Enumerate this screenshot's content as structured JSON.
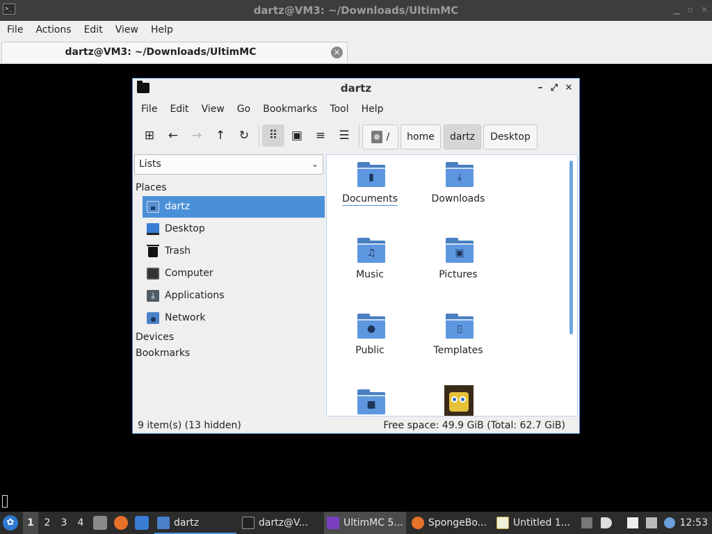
{
  "terminal": {
    "title": "dartz@VM3: ~/Downloads/UltimMC",
    "menu": [
      "File",
      "Actions",
      "Edit",
      "View",
      "Help"
    ],
    "tab_label": "dartz@VM3: ~/Downloads/UltimMC",
    "tab_close": "×",
    "window_controls": [
      "▁",
      "▫",
      "✕"
    ]
  },
  "file_manager": {
    "title": "dartz",
    "controls": {
      "minimize": "–",
      "maximize": "⤢",
      "close": "✕"
    },
    "menu": [
      "File",
      "Edit",
      "View",
      "Go",
      "Bookmarks",
      "Tool",
      "Help"
    ],
    "toolbar": {
      "new_tab": "⊞",
      "back": "←",
      "forward": "→",
      "up": "↑",
      "reload": "↻",
      "icon_view": "⠿",
      "thumbnail_view": "▣",
      "compact_view": "≡",
      "detailed_view": "☰"
    },
    "breadcrumbs": [
      "/",
      "home",
      "dartz",
      "Desktop"
    ],
    "sidebar": {
      "combo_value": "Lists",
      "combo_arrow": "⌄",
      "sections": {
        "places": "Places",
        "devices": "Devices",
        "bookmarks": "Bookmarks"
      },
      "items": [
        {
          "label": "dartz",
          "icon": "home-folder-icon"
        },
        {
          "label": "Desktop",
          "icon": "desktop-icon"
        },
        {
          "label": "Trash",
          "icon": "trash-icon"
        },
        {
          "label": "Computer",
          "icon": "computer-icon"
        },
        {
          "label": "Applications",
          "icon": "applications-icon"
        },
        {
          "label": "Network",
          "icon": "network-icon"
        }
      ]
    },
    "files": [
      {
        "name": "Documents",
        "glyph": "▮"
      },
      {
        "name": "Downloads",
        "glyph": "⤓"
      },
      {
        "name": "Music",
        "glyph": "♫"
      },
      {
        "name": "Pictures",
        "glyph": "▣"
      },
      {
        "name": "Public",
        "glyph": "●"
      },
      {
        "name": "Templates",
        "glyph": "▯"
      },
      {
        "name": "",
        "glyph": "■"
      }
    ],
    "status": {
      "items": "9 item(s) (13 hidden)",
      "space": "Free space: 49.9 GiB (Total: 62.7 GiB)"
    }
  },
  "taskbar": {
    "start_glyph": "✿",
    "workspaces": [
      "1",
      "2",
      "3",
      "4"
    ],
    "tasks": [
      "dartz",
      "dartz@V...",
      "UltimMC 5...",
      "SpongeBo...",
      "Untitled 1..."
    ],
    "clock": "12:53"
  },
  "colors": {
    "accent": "#4a90d9",
    "folder": "#5e97df",
    "taskbar": "#2c2c2c"
  }
}
